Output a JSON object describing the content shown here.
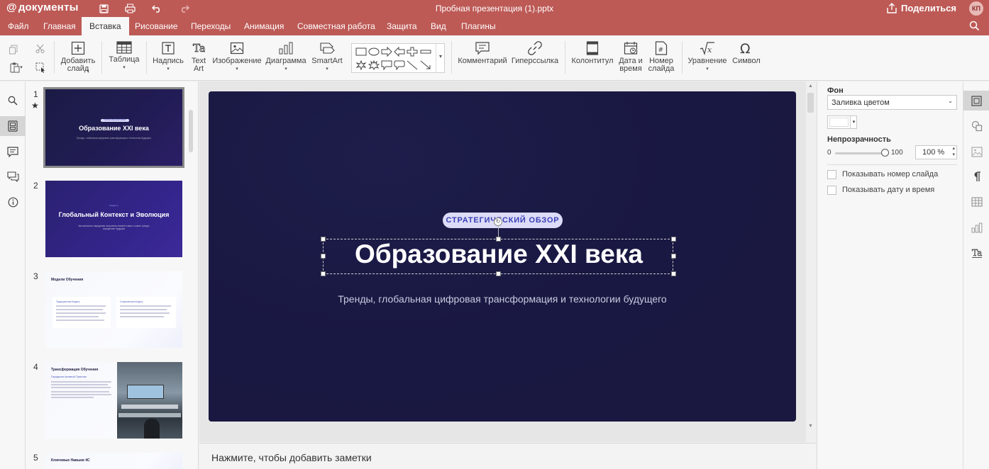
{
  "app": {
    "logo_at": "@",
    "logo_text": "документы",
    "doc_title": "Пробная презентация (1).pptx",
    "share_label": "Поделиться",
    "avatar": "КП"
  },
  "menu": {
    "tabs": [
      "Файл",
      "Главная",
      "Вставка",
      "Рисование",
      "Переходы",
      "Анимация",
      "Совместная работа",
      "Защита",
      "Вид",
      "Плагины"
    ],
    "active": "Вставка"
  },
  "toolbar": {
    "add_slide": "Добавить слайд",
    "table": "Таблица",
    "textbox": "Надпись",
    "textart": "Text Art",
    "image": "Изображение",
    "chart": "Диаграмма",
    "smartart": "SmartArt",
    "comment": "Комментарий",
    "hyperlink": "Гиперссылка",
    "header_footer": "Колонтитул",
    "date_time": "Дата и время",
    "slide_number": "Номер слайда",
    "equation": "Уравнение",
    "symbol": "Символ"
  },
  "thumbnails": [
    {
      "num": "1",
      "badge": "СТРАТЕГИЧЕСКИЙ ОБЗОР",
      "title": "Образование XXI века",
      "sub": "Тренды, глобальная цифровая трансформация и технологии будущего"
    },
    {
      "num": "2",
      "kicker": "Раздел 1",
      "title": "Глобальный Контекст и Эволюция",
      "sub": "Как меняются парадигмы получения знаний в мире и какие тренды определяют будущее"
    },
    {
      "num": "3",
      "title": "Модели Обучения",
      "col1_head": "Традиционная Модель",
      "col2_head": "Современная Модель"
    },
    {
      "num": "4",
      "title": "Трансформация Обучения",
      "kicker": "Парадигма Активной Практики"
    },
    {
      "num": "5",
      "title": "Ключевые Навыки 4С"
    }
  ],
  "slide": {
    "badge": "СТРАТЕГИЧЕСКИЙ ОБЗОР",
    "title": "Образование XXI века",
    "subtitle": "Тренды, глобальная цифровая трансформация и технологии будущего"
  },
  "notes": {
    "placeholder": "Нажмите, чтобы добавить заметки"
  },
  "right_panel": {
    "background_label": "Фон",
    "fill_type": "Заливка цветом",
    "opacity_label": "Непрозрачность",
    "opacity_min": "0",
    "opacity_max": "100",
    "opacity_value": "100 %",
    "show_slide_number": "Показывать номер слайда",
    "show_date_time": "Показывать дату и время"
  }
}
